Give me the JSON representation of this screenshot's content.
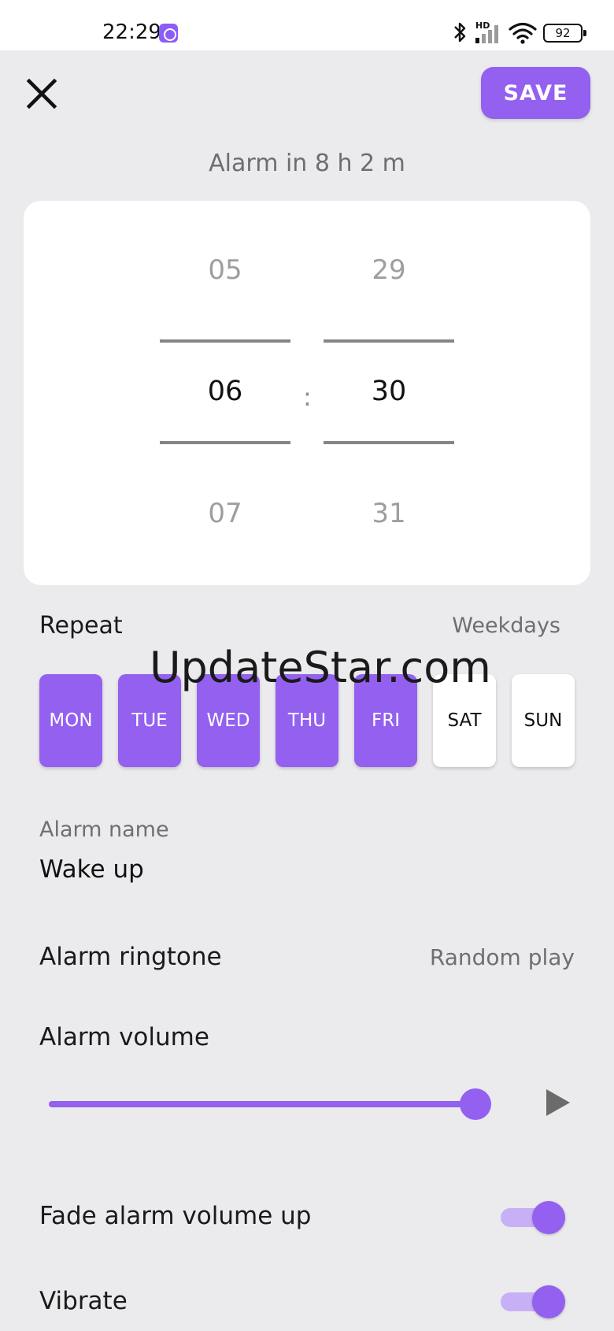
{
  "status_bar": {
    "time": "22:29",
    "network_label": "HD",
    "battery": "92",
    "app_icon": "alarm-clock-icon"
  },
  "header": {
    "close_icon": "close-icon",
    "save_label": "SAVE"
  },
  "alarm_in_text": "Alarm in 8 h 2 m",
  "time_picker": {
    "hours": {
      "prev": "05",
      "selected": "06",
      "next": "07"
    },
    "minutes": {
      "prev": "29",
      "selected": "30",
      "next": "31"
    },
    "separator": ":"
  },
  "repeat": {
    "label": "Repeat",
    "value": "Weekdays",
    "days": [
      {
        "label": "MON",
        "selected": true
      },
      {
        "label": "TUE",
        "selected": true
      },
      {
        "label": "WED",
        "selected": true
      },
      {
        "label": "THU",
        "selected": true
      },
      {
        "label": "FRI",
        "selected": true
      },
      {
        "label": "SAT",
        "selected": false
      },
      {
        "label": "SUN",
        "selected": false
      }
    ]
  },
  "watermark": "UpdateStar.com",
  "alarm_name": {
    "label": "Alarm name",
    "value": "Wake up"
  },
  "ringtone": {
    "label": "Alarm ringtone",
    "value": "Random play"
  },
  "volume": {
    "label": "Alarm volume",
    "level": 1.0
  },
  "fade": {
    "label": "Fade alarm volume up",
    "enabled": true
  },
  "vibrate": {
    "label": "Vibrate",
    "enabled": true
  },
  "colors": {
    "accent": "#9360f0",
    "background": "#ebebed"
  }
}
